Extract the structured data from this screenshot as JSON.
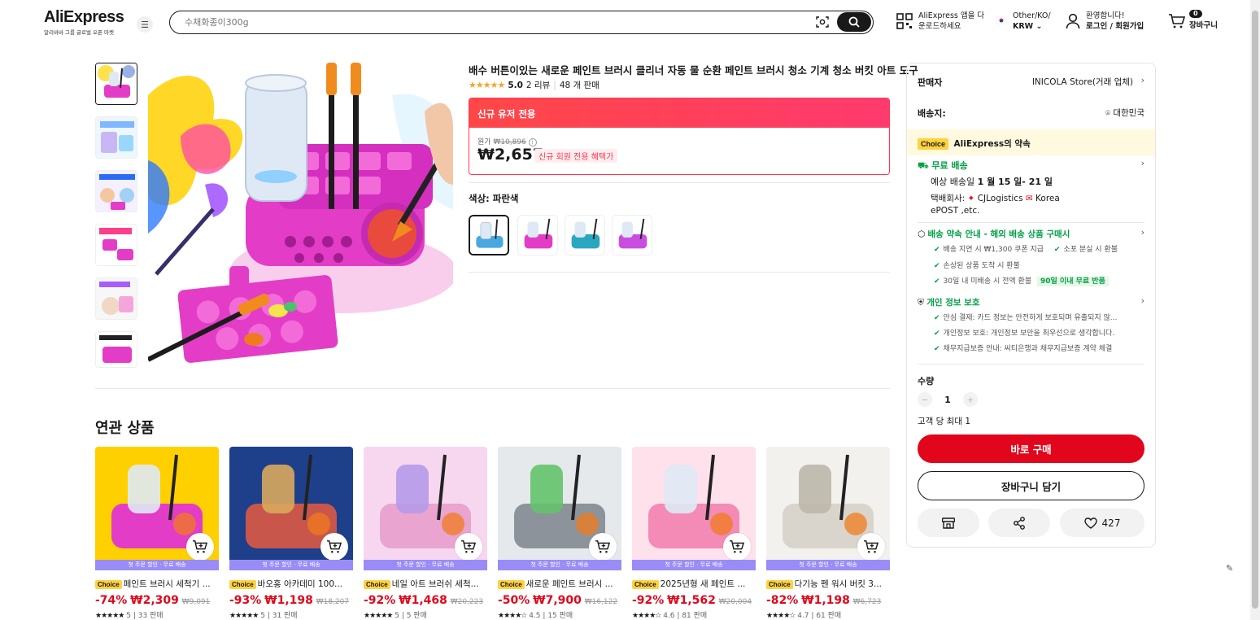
{
  "header": {
    "logo": "AliExpress",
    "logo_sub": "알리바바 그룹 글로벌 오픈 마켓",
    "search_placeholder": "수채화종이300g",
    "app_line1": "AliExpress 앱을 다",
    "app_line2": "운로드하세요",
    "region_line1": "Other/KO/",
    "region_line2": "KRW",
    "user_line1": "환영합니다!",
    "user_line2": "로그인 / 회원가입",
    "cart_count": "0",
    "cart_label": "장바구니"
  },
  "product": {
    "title": "배수 버튼이있는 새로운 페인트 브러시 클리너 자동 물 순환 페인트 브러시 청소 기계 청소 버킷 아트 도구",
    "stars": "★★★★★",
    "rating": "5.0",
    "reviews": "2 리뷰",
    "sold": "48 개 판매",
    "promo_label": "신규 유저 전용",
    "original_label": "원가",
    "original_price": "₩10,896",
    "price": "₩2,657",
    "price_tag": "신규 회원 전용 혜택가",
    "color_label": "색상: 파란색"
  },
  "panel": {
    "seller_label": "판매자",
    "seller_value": "INICOLA Store(거래 업체)",
    "ship_label": "배송지:",
    "ship_value": "대한민국",
    "choice_tag": "Choice",
    "choice_title": "AliExpress의 약속",
    "free_ship": "무료 배송",
    "est_prefix": "예상 배송일",
    "est_date": "1 월 15 일- 21 일",
    "carrier_label": "택배회사:",
    "carrier1": "CJLogistics",
    "carrier2": "Korea",
    "carrier3": "ePOST ,etc.",
    "promise_title": "배송 약속 안내 - 해외 배송 상품 구매시",
    "promise1": "배송 지연 시 ₩1,300 쿠폰 지급",
    "promise2": "소포 분실 시 환불",
    "promise3": "손상된 상품 도착 시 환불",
    "promise4": "30일 내 미배송 시 전액 환불",
    "promise4_tag": "90일 이내 무료 반품",
    "privacy_title": "개인 정보 보호",
    "privacy1": "안심 결제: 카드 정보는 안전하게 보호되며 유출되지 않...",
    "privacy2": "개인정보 보호: 개인정보 보안을 최우선으로 생각합니다.",
    "privacy3": "채무지급보증 안내: 씨티은행과 채무지급보증 계약 체결",
    "qty_label": "수량",
    "qty_value": "1",
    "qty_limit": "고객 당 최대 1",
    "buy_now": "바로 구매",
    "add_cart": "장바구니 담기",
    "wish_count": "427"
  },
  "related": {
    "title": "연관 상품",
    "strip": "첫 주문 할인 · 무료 배송",
    "items": [
      {
        "name": "페인트 브러시 세척기 ...",
        "disc": "-74%",
        "price": "₩2,309",
        "old": "₩9,091",
        "stars": "★★★★★",
        "rating": "5",
        "sold": "33 판매"
      },
      {
        "name": "바오홍 아카데미 100...",
        "disc": "-93%",
        "price": "₩1,198",
        "old": "₩18,207",
        "stars": "★★★★★",
        "rating": "5",
        "sold": "31 판매"
      },
      {
        "name": "네일 아트 브러쉬 세척...",
        "disc": "-92%",
        "price": "₩1,468",
        "old": "₩20,223",
        "stars": "★★★★★",
        "rating": "5",
        "sold": "5 판매"
      },
      {
        "name": "새로운 페인트 브러시 ...",
        "disc": "-50%",
        "price": "₩7,900",
        "old": "₩16,122",
        "stars": "★★★★☆",
        "rating": "4.5",
        "sold": "15 판매"
      },
      {
        "name": "2025년형 새 페인트 ...",
        "disc": "-92%",
        "price": "₩1,562",
        "old": "₩20,004",
        "stars": "★★★★☆",
        "rating": "4.6",
        "sold": "81 판매"
      },
      {
        "name": "다기능 펜 워시 버킷 3...",
        "disc": "-82%",
        "price": "₩1,198",
        "old": "₩6,723",
        "stars": "★★★★☆",
        "rating": "4.7",
        "sold": "61 판매"
      }
    ]
  },
  "colors": {
    "accent_red": "#e1061b",
    "promo_red": "#fd384f",
    "choice_yellow": "#ffd240",
    "green": "#00a046",
    "strip_purple": "#9a8cf7"
  }
}
